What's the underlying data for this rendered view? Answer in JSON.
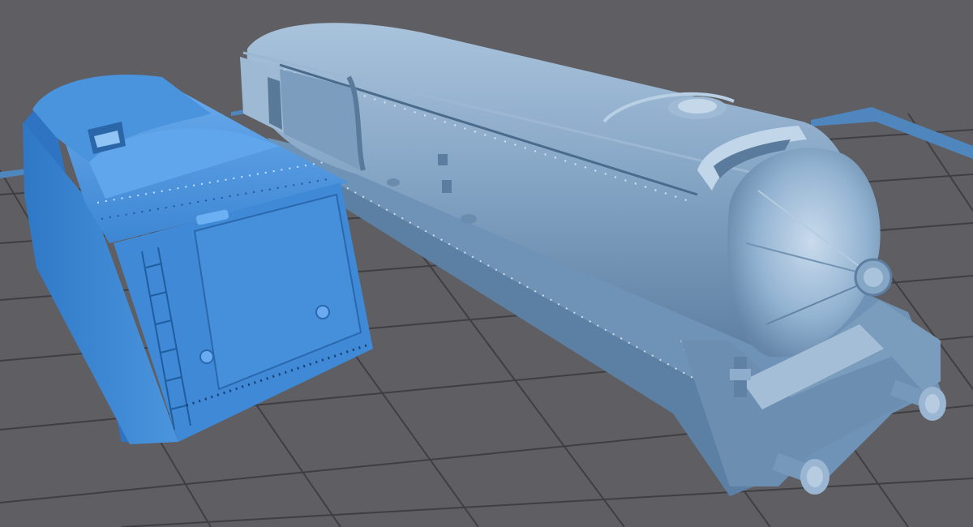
{
  "viewport": {
    "background": "#5f5f63",
    "grid_color": "#3e3e42",
    "plate_edge_color": "#4c7fb3"
  },
  "models": [
    {
      "id": "tender",
      "color": "#3f89d6"
    },
    {
      "id": "locomotive_shell",
      "color": "#7fa2c4"
    }
  ]
}
